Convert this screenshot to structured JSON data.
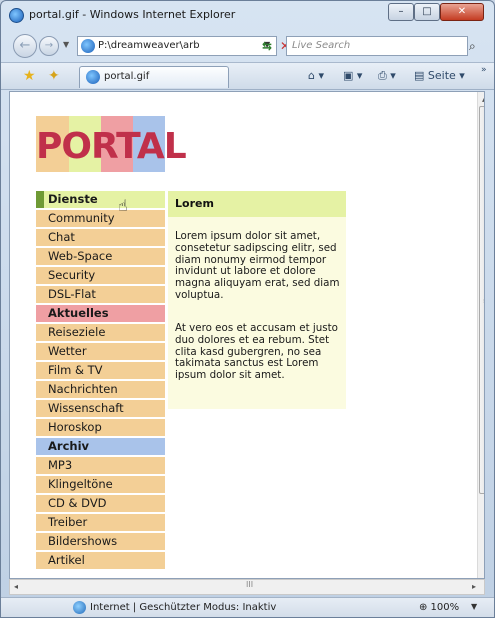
{
  "window": {
    "title": "portal.gif - Windows Internet Explorer",
    "min_glyph": "–",
    "max_glyph": "□",
    "close_glyph": "✕"
  },
  "addressbar": {
    "url": "P:\\dreamweaver\\arb",
    "search_placeholder": "Live Search",
    "back_glyph": "←",
    "fwd_glyph": "→",
    "drop_glyph": "▼",
    "refresh_glyph": "⇆",
    "stop_glyph": "✕",
    "search_glyph": "⌕"
  },
  "tabbar": {
    "tab_title": "portal.gif",
    "favorites_glyph": "★",
    "add_favorites_glyph": "✦",
    "home_label": "⌂ ▾",
    "feeds_label": "▣ ▾",
    "print_label": "⎙ ▾",
    "page_label": "▤ Seite ▾",
    "more_label": "»"
  },
  "page": {
    "logo": "PORTAL",
    "logo_colors": [
      "#f3cf96",
      "#e5f2a4",
      "#ef9fa3",
      "#a9c3ea"
    ],
    "menu": [
      {
        "label": "Dienste",
        "type": "head-green"
      },
      {
        "label": "Community",
        "type": "item"
      },
      {
        "label": "Chat",
        "type": "item"
      },
      {
        "label": "Web-Space",
        "type": "item"
      },
      {
        "label": "Security",
        "type": "item"
      },
      {
        "label": "DSL-Flat",
        "type": "item"
      },
      {
        "label": "Aktuelles",
        "type": "head-pink"
      },
      {
        "label": "Reiseziele",
        "type": "item"
      },
      {
        "label": "Wetter",
        "type": "item"
      },
      {
        "label": "Film & TV",
        "type": "item"
      },
      {
        "label": "Nachrichten",
        "type": "item"
      },
      {
        "label": "Wissenschaft",
        "type": "item"
      },
      {
        "label": "Horoskop",
        "type": "item"
      },
      {
        "label": "Archiv",
        "type": "head-blue"
      },
      {
        "label": "MP3",
        "type": "item"
      },
      {
        "label": "Klingeltöne",
        "type": "item"
      },
      {
        "label": "CD & DVD",
        "type": "item"
      },
      {
        "label": "Treiber",
        "type": "item"
      },
      {
        "label": "Bildershows",
        "type": "item"
      },
      {
        "label": "Artikel",
        "type": "item"
      }
    ],
    "content_title": "Lorem",
    "paragraph1": "Lorem ipsum dolor sit amet, consetetur sadipscing elitr, sed diam nonumy eirmod tempor invidunt ut labore et dolore magna aliquyam erat, sed diam voluptua.",
    "paragraph2": "At vero eos et accusam et justo duo dolores et ea rebum. Stet clita kasd gubergren, no sea takimata sanctus est Lorem ipsum dolor sit amet.",
    "cursor_glyph": "☝"
  },
  "scroll": {
    "up_glyph": "▲",
    "grip_glyph": "≡",
    "left_glyph": "◂",
    "hgrip_glyph": "III",
    "right_glyph": "▸"
  },
  "statusbar": {
    "zone_text": "Internet | Geschützter Modus: Inaktiv",
    "zoom": "⊕ 100%",
    "zoom_drop": "▼"
  }
}
